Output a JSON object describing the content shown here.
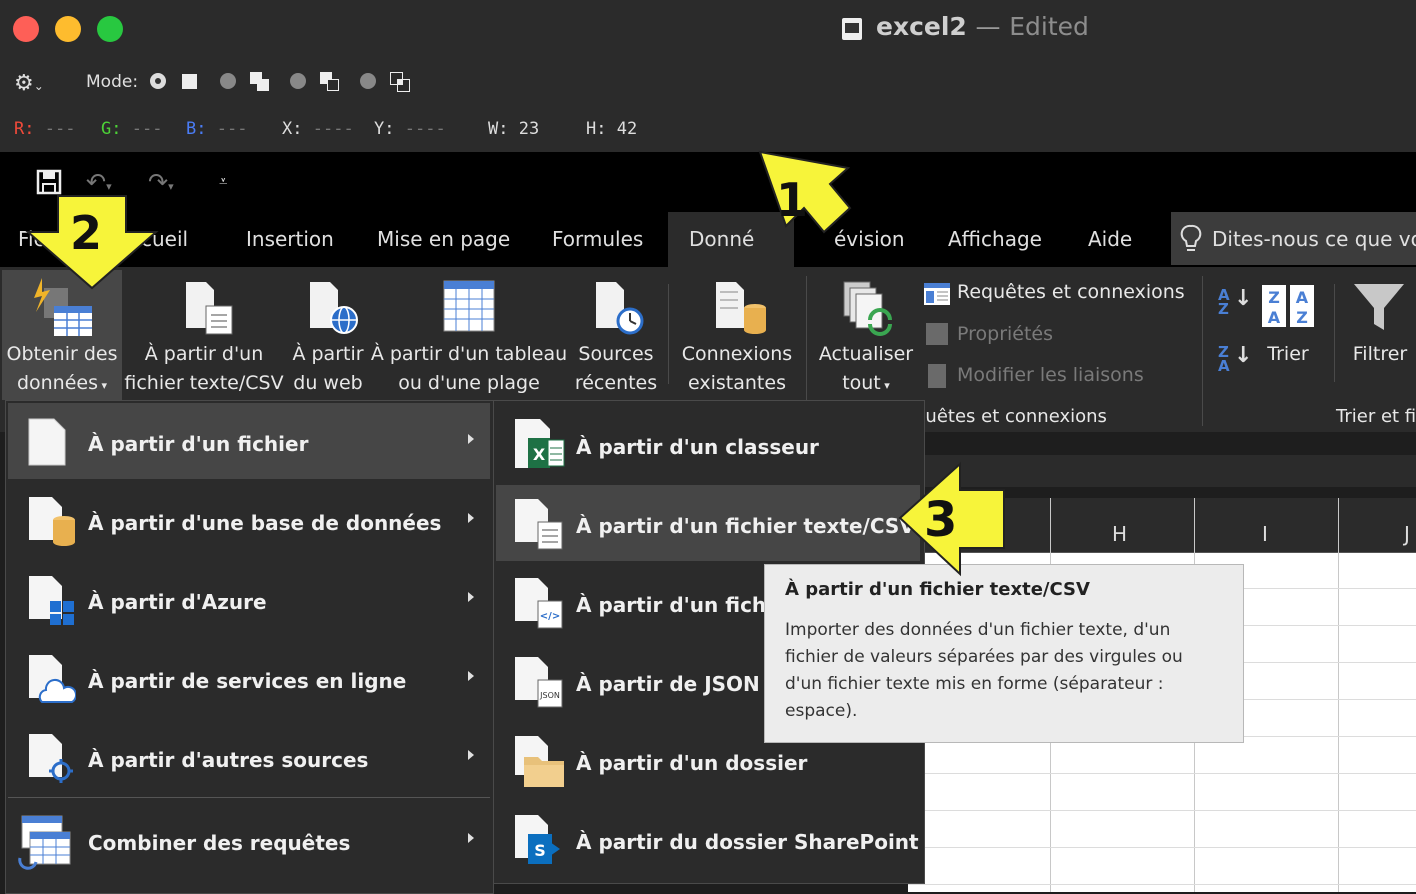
{
  "window": {
    "title": "excel2",
    "separator": "—",
    "status": "Edited"
  },
  "toolbar": {
    "mode_label": "Mode:",
    "r_label": "R:",
    "r_value": "---",
    "g_label": "G:",
    "g_value": "---",
    "b_label": "B:",
    "b_value": "---",
    "x_label": "X:",
    "x_value": "----",
    "y_label": "Y:",
    "y_value": "----",
    "w_label": "W:",
    "w_value": "23",
    "h_label": "H:",
    "h_value": "42"
  },
  "tabs": {
    "fichier": "Fic",
    "accueil": "ccueil",
    "insertion": "Insertion",
    "mise_en_page": "Mise en page",
    "formules": "Formules",
    "donnees": "Donné",
    "revision": "évision",
    "affichage": "Affichage",
    "aide": "Aide",
    "tell_me": "Dites-nous ce que vo"
  },
  "ribbon": {
    "obtenir_1": "Obtenir des",
    "obtenir_2": "données",
    "texte_1": "À partir d'un",
    "texte_2": "fichier texte/CSV",
    "web_1": "À partir",
    "web_2": "du web",
    "tableau_1": "À partir d'un tableau",
    "tableau_2": "ou d'une plage",
    "sources_1": "Sources",
    "sources_2": "récentes",
    "connexions_1": "Connexions",
    "connexions_2": "existantes",
    "actualiser_1": "Actualiser",
    "actualiser_2": "tout",
    "requetes": "Requêtes et connexions",
    "proprietes": "Propriétés",
    "liaisons": "Modifier les liaisons",
    "group_requetes": "quêtes et connexions",
    "trier": "Trier",
    "filtrer": "Filtrer",
    "group_trier": "Trier et fi"
  },
  "columns": {
    "h": "H",
    "i": "I",
    "j": "J"
  },
  "menu1": [
    {
      "label": "À partir d'un fichier"
    },
    {
      "label": "À partir d'une base de données"
    },
    {
      "label": "À partir d'Azure"
    },
    {
      "label": "À partir de services en ligne"
    },
    {
      "label": "À partir d'autres sources"
    },
    {
      "label": "Combiner des requêtes"
    }
  ],
  "menu2": [
    {
      "label": "À partir d'un classeur"
    },
    {
      "label": "À partir d'un fichier texte/CSV"
    },
    {
      "label": "À partir d'un fichie"
    },
    {
      "label": "À partir de JSON"
    },
    {
      "label": "À partir d'un dossier"
    },
    {
      "label": "À partir du dossier SharePoint"
    }
  ],
  "tooltip": {
    "title": "À partir d'un fichier texte/CSV",
    "line1": "Importer des données d'un fichier texte, d'un",
    "line2": "fichier de valeurs séparées par des virgules ou",
    "line3": "d'un fichier texte mis en forme (séparateur :",
    "line4": "espace)."
  },
  "callouts": {
    "one": "1",
    "two": "2",
    "three": "3"
  },
  "colors": {
    "callout": "#f7f43a",
    "titlebar": "#2b2b2b",
    "ribbon": "#2b2b2b",
    "menu_hover": "#464646"
  }
}
